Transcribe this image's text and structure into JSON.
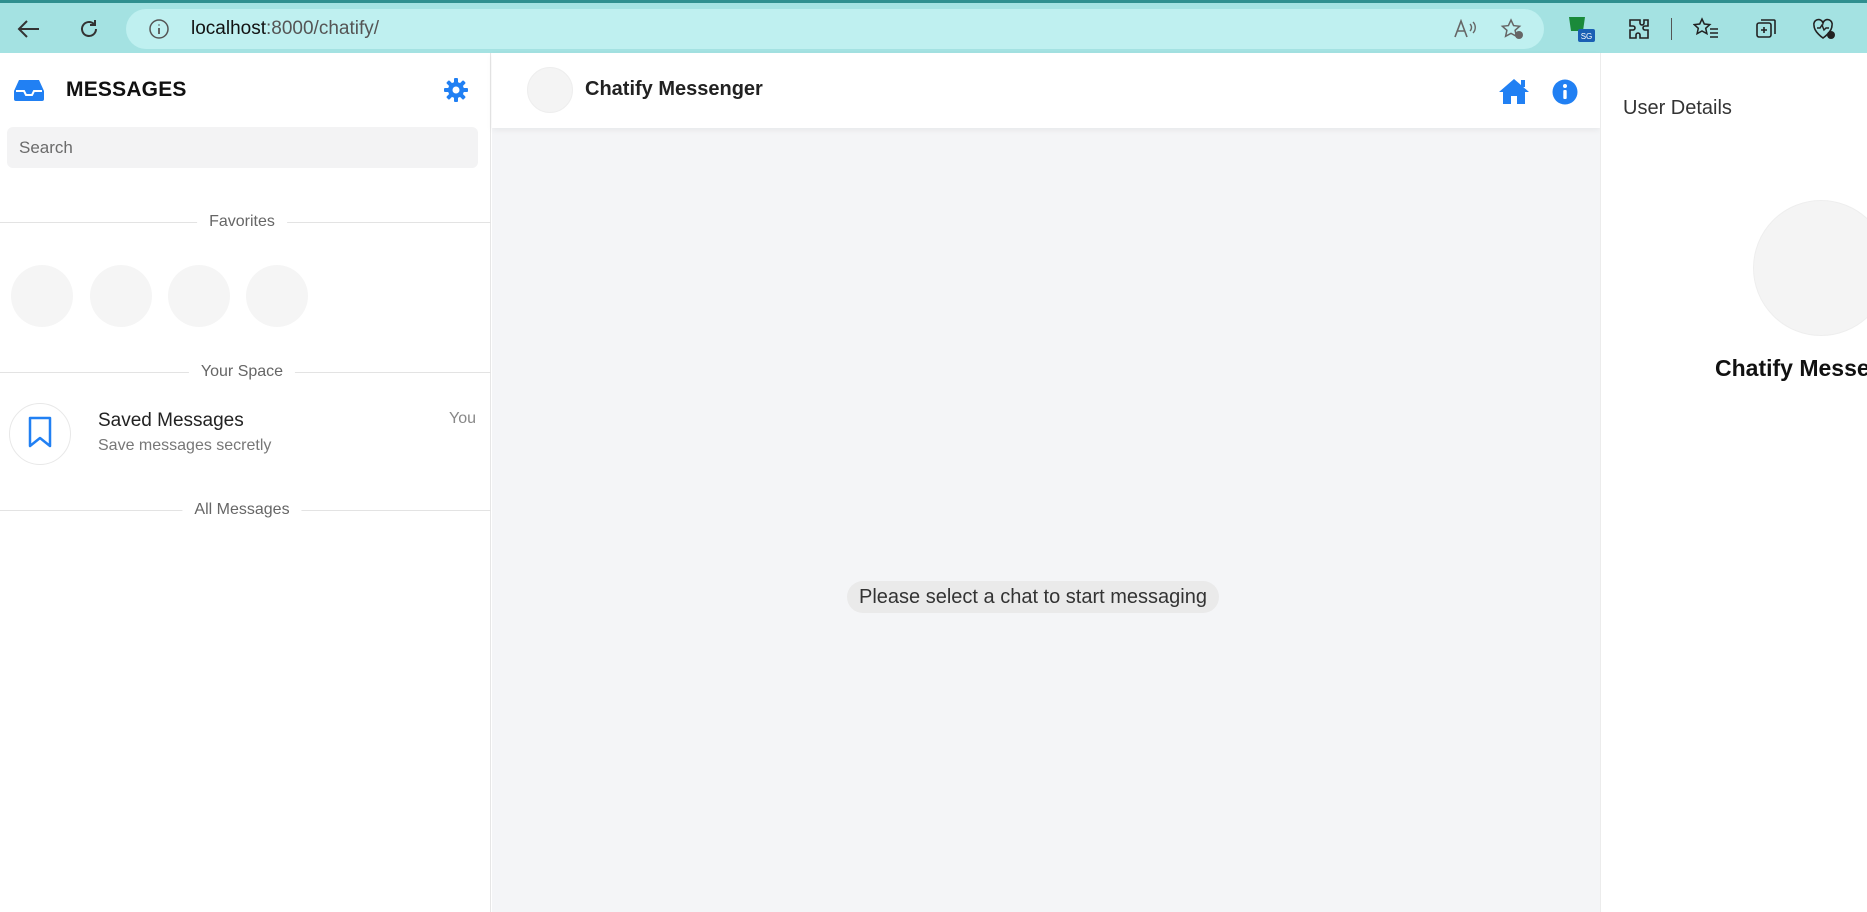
{
  "browser": {
    "url_host": "localhost",
    "url_path": ":8000/chatify/"
  },
  "sidebar": {
    "title": "MESSAGES",
    "search_placeholder": "Search",
    "sections": {
      "favorites": "Favorites",
      "your_space": "Your Space",
      "all_messages": "All Messages"
    },
    "saved": {
      "title": "Saved Messages",
      "subtitle": "Save messages secretly",
      "meta": "You"
    }
  },
  "chat": {
    "title": "Chatify Messenger",
    "empty_message": "Please select a chat to start messaging"
  },
  "details": {
    "title": "User Details",
    "name": "Chatify Messenger"
  },
  "colors": {
    "accent": "#2180f3",
    "browser_bar": "#a4e2e2"
  },
  "icons": {
    "inbox": "inbox-icon",
    "settings": "gear-icon",
    "saved": "bookmark-icon",
    "home": "home-icon",
    "info": "info-icon"
  }
}
